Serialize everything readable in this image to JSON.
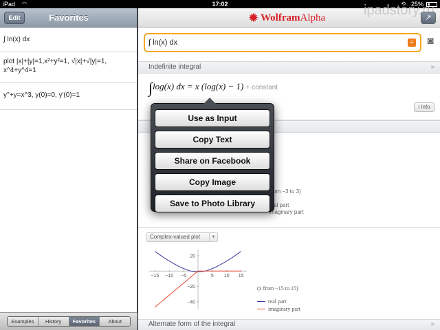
{
  "status_bar": {
    "carrier": "iPad",
    "time": "17:02",
    "battery": "25%"
  },
  "left_panel": {
    "edit_label": "Edit",
    "title": "Favorites",
    "items": [
      "∫ ln(x) dx",
      "plot |x|+|y|=1,x²+y²=1, √|x|+√|y|=1, x^4+y^4=1",
      "y''+y=x^3, y(0)=0, y'(0)=1"
    ],
    "tabs": [
      "Examples",
      "History",
      "Favorites",
      "About"
    ],
    "active_tab": "Favorites"
  },
  "right_panel": {
    "logo_wolfram": "Wolfram",
    "logo_alpha": "Alpha",
    "watermark": "ipadstory.ru",
    "query": "∫ ln(x) dx",
    "result_pod": {
      "title": "Indefinite integral",
      "formula_main": "log(x) dx = x (log(x) − 1)",
      "formula_constant": "+ constant",
      "info_label": "Info"
    },
    "partial_texts": {
      "range": "om −3 to 3)",
      "real": "real part",
      "imag": "imaginary part"
    },
    "complex_select": "Complex-valued plot",
    "plot": {
      "caption": "(x from −15 to 15)",
      "legend_real": "real part",
      "legend_imag": "imaginary part"
    },
    "bottom_pod_title": "Alternate form of the integral"
  },
  "popover": {
    "items": [
      "Use as Input",
      "Copy Text",
      "Share on Facebook",
      "Copy Image",
      "Save to Photo Library"
    ]
  },
  "chart_data": {
    "type": "line",
    "title": "",
    "xlabel": "",
    "ylabel": "",
    "xlim": [
      -17,
      17
    ],
    "ylim": [
      -50,
      28
    ],
    "x_ticks": [
      -15,
      -10,
      -5,
      5,
      10,
      15
    ],
    "y_ticks": [
      20,
      -20,
      -40
    ],
    "series": [
      {
        "name": "real part",
        "color": "#3b3b9e",
        "x": [
          -15,
          -12,
          -9,
          -6,
          -3,
          -1,
          0,
          1,
          3,
          6,
          9,
          12,
          15
        ],
        "y": [
          25.6,
          17.8,
          10.8,
          4.8,
          0.3,
          -1,
          -1,
          -1,
          0.3,
          4.8,
          10.8,
          17.8,
          25.6
        ]
      },
      {
        "name": "imaginary part",
        "color": "#e8452c",
        "x": [
          -15,
          -12,
          -9,
          -6,
          -3,
          -1,
          0,
          1,
          3,
          6,
          9,
          12,
          15
        ],
        "y": [
          -47.1,
          -37.7,
          -28.3,
          -18.8,
          -9.4,
          -3.1,
          0,
          0,
          0,
          0,
          0,
          0,
          0
        ]
      }
    ]
  }
}
